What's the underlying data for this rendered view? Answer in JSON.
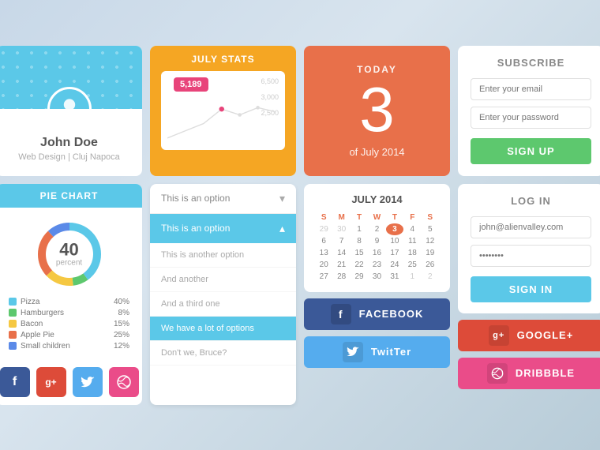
{
  "profile": {
    "name": "John Doe",
    "subtitle": "Web Design | Cluj Napoca"
  },
  "stats": {
    "title": "JULY STATS",
    "badge": "5,189",
    "labels": [
      "6,500",
      "3,000",
      "2,500"
    ]
  },
  "today": {
    "label": "TODAY",
    "number": "3",
    "sub": "of July 2014"
  },
  "subscribe": {
    "title": "SUBSCRIBE",
    "email_placeholder": "Enter your email",
    "password_placeholder": "Enter your password",
    "button": "SIGN UP"
  },
  "piechart": {
    "header": "PIE CHART",
    "center_num": "40",
    "center_label": "percent",
    "legend": [
      {
        "label": "Pizza",
        "pct": "40%",
        "color": "#5bc8e8"
      },
      {
        "label": "Hamburgers",
        "pct": "8%",
        "color": "#5dc86e"
      },
      {
        "label": "Bacon",
        "pct": "15%",
        "color": "#f5c842"
      },
      {
        "label": "Apple Pie",
        "pct": "25%",
        "color": "#e8704a"
      },
      {
        "label": "Small children",
        "pct": "12%",
        "color": "#5b8ae8"
      }
    ]
  },
  "dropdown": {
    "closed_text": "This is an option",
    "open_text": "This is an option",
    "options": [
      "This is another option",
      "And another",
      "And a third one",
      "We have a lot of options",
      "Don't we, Bruce?"
    ]
  },
  "calendar": {
    "title": "JULY 2014",
    "days_header": [
      "S",
      "M",
      "T",
      "W",
      "T",
      "F",
      "S"
    ],
    "weeks": [
      [
        "29",
        "30",
        "1",
        "2",
        "3",
        "4",
        "5"
      ],
      [
        "6",
        "7",
        "8",
        "9",
        "10",
        "11",
        "12"
      ],
      [
        "13",
        "14",
        "15",
        "16",
        "17",
        "18",
        "19"
      ],
      [
        "20",
        "21",
        "22",
        "23",
        "24",
        "25",
        "26"
      ],
      [
        "27",
        "28",
        "29",
        "30",
        "31",
        "1",
        "2"
      ]
    ],
    "today_day": "3",
    "muted_days": [
      "29",
      "30",
      "1",
      "2"
    ]
  },
  "login": {
    "title": "LOG IN",
    "email_value": "john@alienvalley.com",
    "password_value": "••••••••",
    "button": "SIGN IN"
  },
  "social_icons": [
    {
      "name": "facebook",
      "color": "#3b5998",
      "label": "f"
    },
    {
      "name": "google-plus",
      "color": "#dd4b39",
      "label": "g+"
    },
    {
      "name": "twitter",
      "color": "#55acee",
      "label": "t"
    },
    {
      "name": "dribbble",
      "color": "#ea4c89",
      "label": "d"
    }
  ],
  "social_buttons": [
    {
      "name": "facebook-wide",
      "color": "#3b5998",
      "label": "FACEBOOK",
      "icon_label": "f"
    },
    {
      "name": "twitter-wide",
      "color": "#55acee",
      "label": "TWITTER",
      "icon_label": "t"
    },
    {
      "name": "google-plus-wide",
      "color": "#dd4b39",
      "label": "GOOGLE+",
      "icon_label": "g+"
    },
    {
      "name": "dribbble-wide",
      "color": "#ea4c89",
      "label": "DRIBBBLE",
      "icon_label": "d"
    }
  ]
}
